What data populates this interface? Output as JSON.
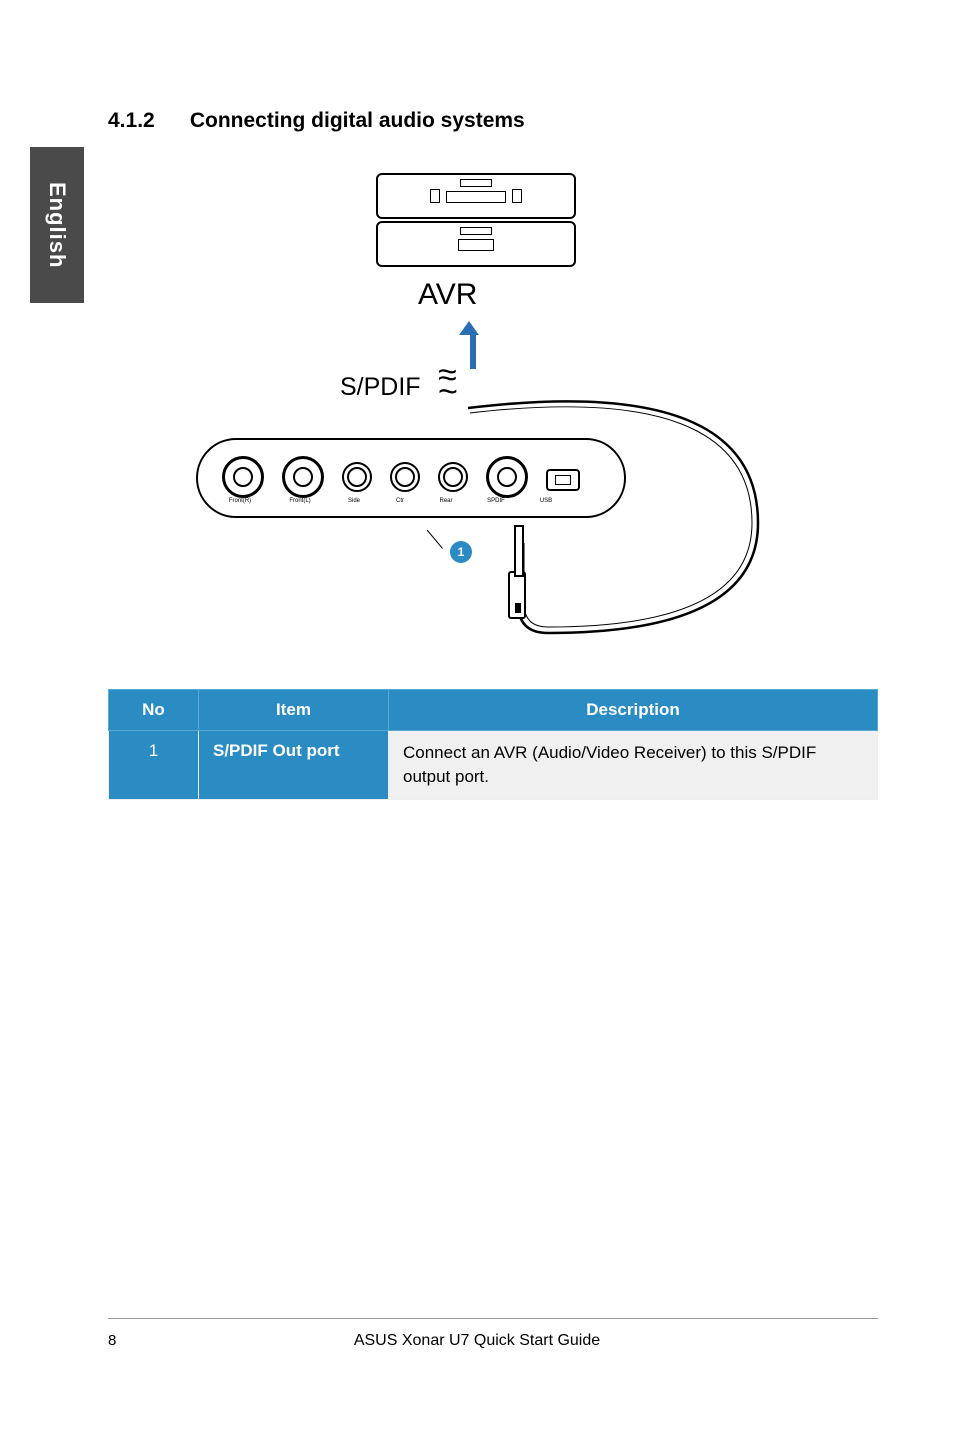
{
  "side_tab": "English",
  "heading": {
    "number": "4.1.2",
    "title": "Connecting digital audio systems"
  },
  "diagram": {
    "avr_label": "AVR",
    "spdif_label": "S/PDIF",
    "callout_number": "1",
    "port_labels": [
      "Front(R)",
      "Front(L)",
      "Side",
      "Ctr",
      "Rear",
      "SPDIF",
      "USB"
    ]
  },
  "table": {
    "headers": {
      "no": "No",
      "item": "Item",
      "description": "Description"
    },
    "rows": [
      {
        "no": "1",
        "item": "S/PDIF Out port",
        "description": "Connect an AVR (Audio/Video Receiver) to this S/PDIF output port."
      }
    ]
  },
  "footer": {
    "page": "8",
    "title": "ASUS Xonar U7 Quick Start Guide"
  }
}
